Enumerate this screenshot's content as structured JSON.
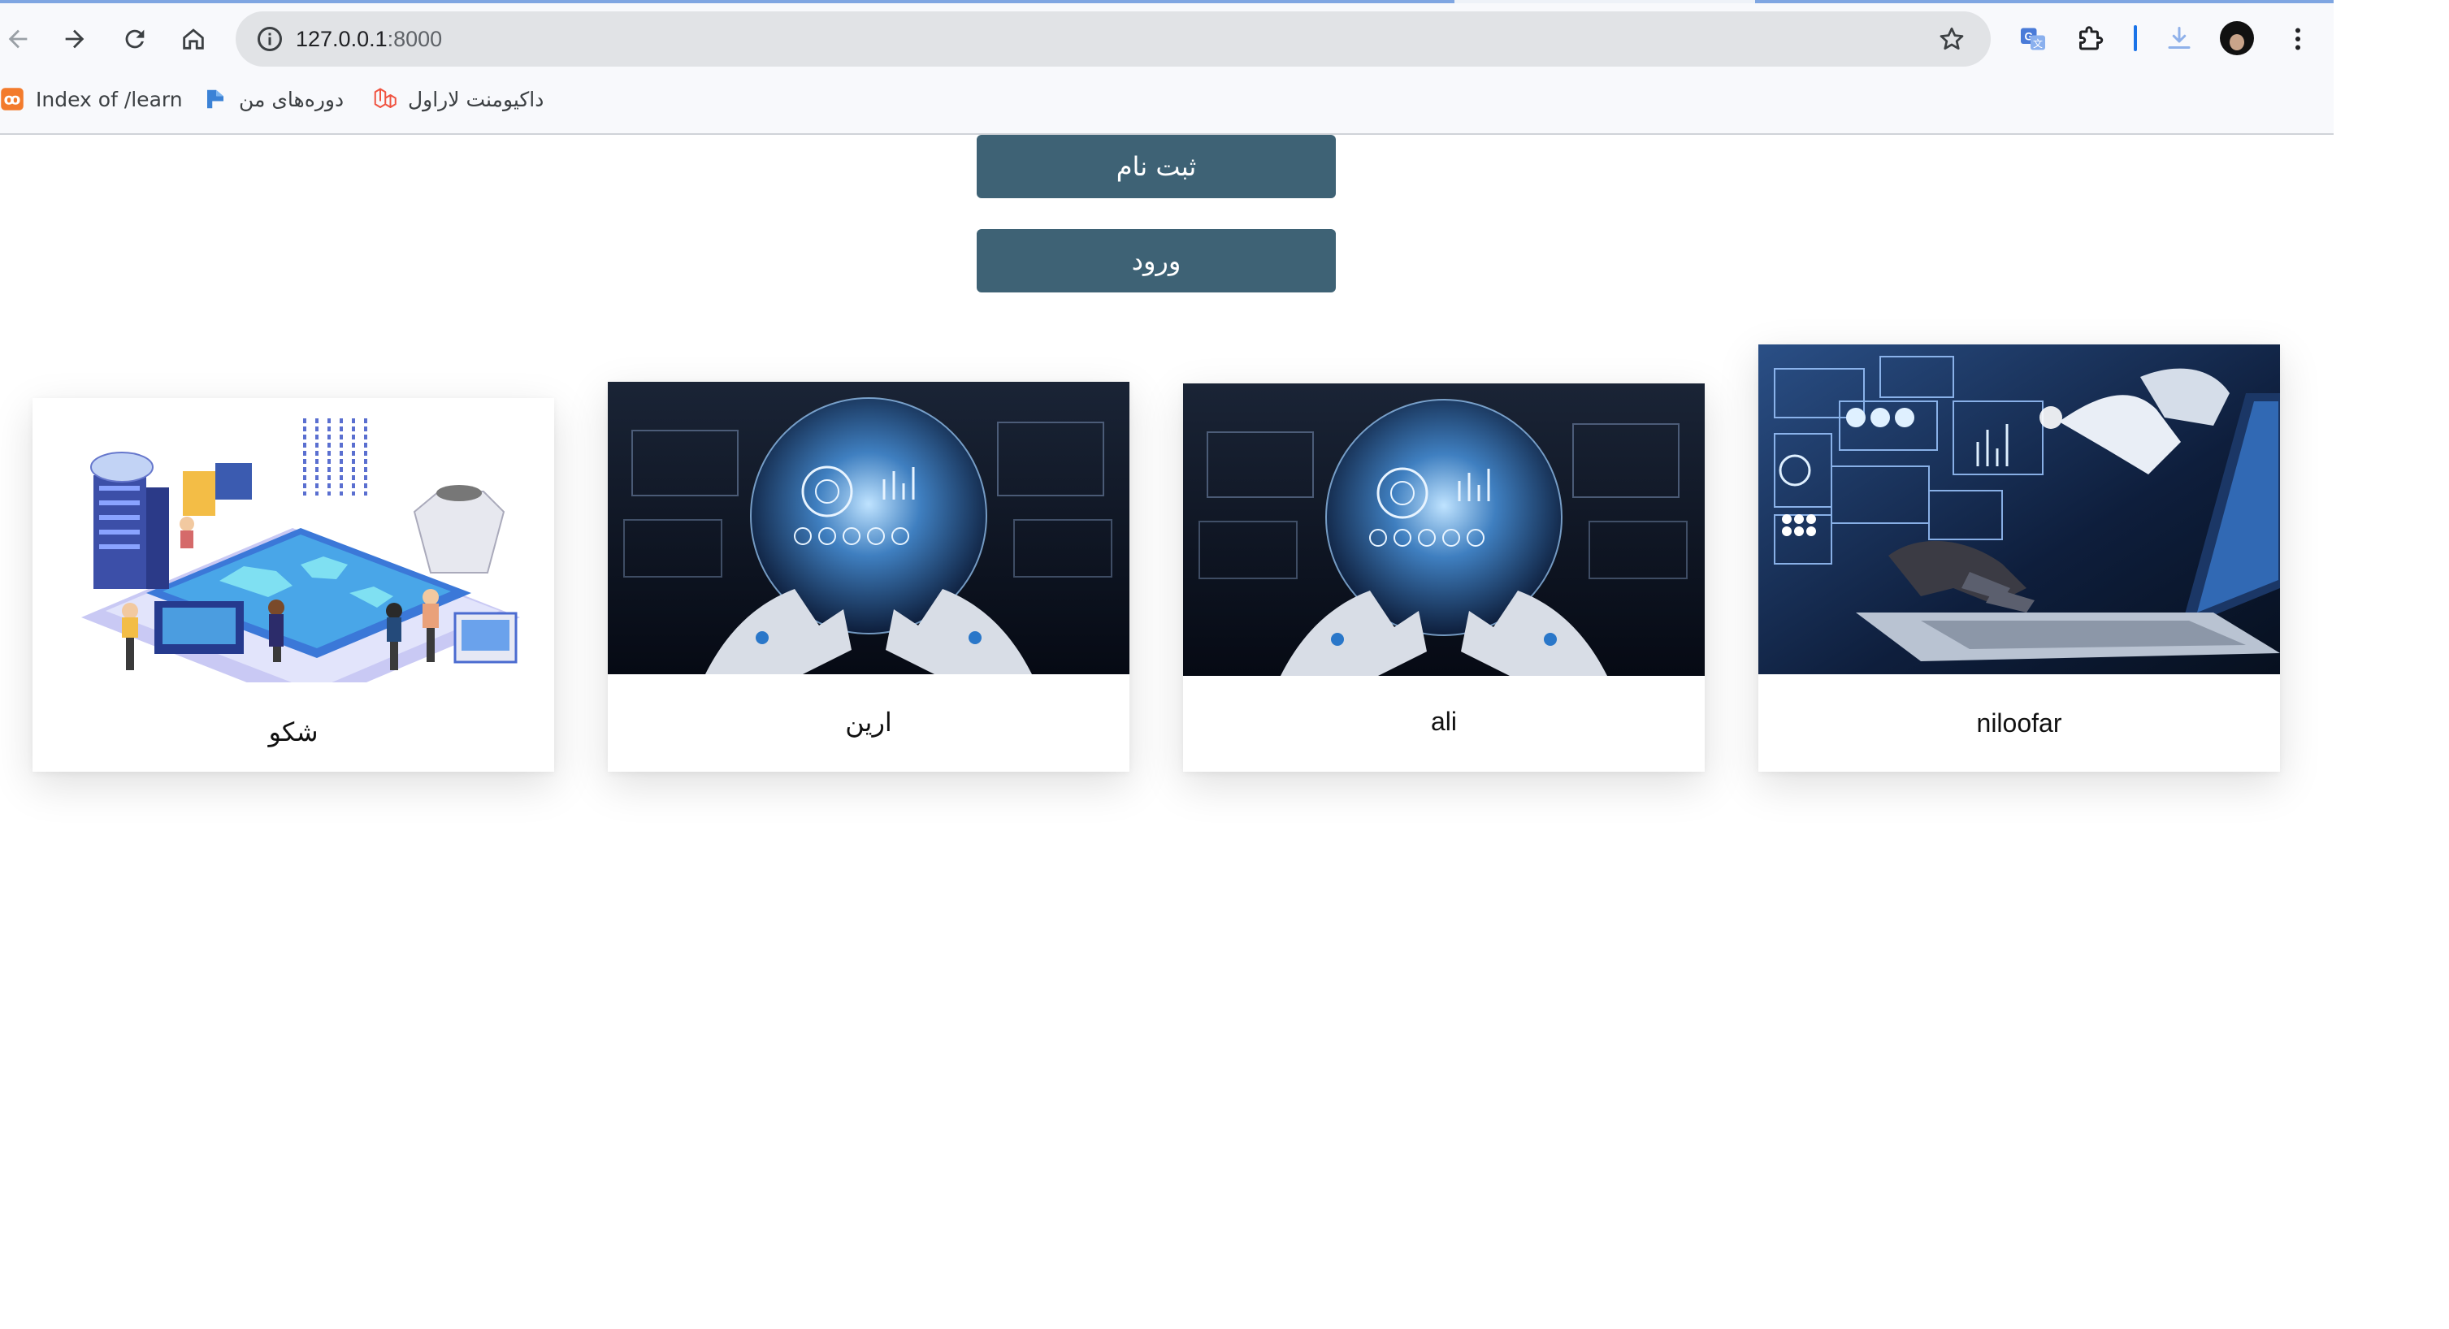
{
  "browser": {
    "url_host": "127.0.0.1",
    "url_port": ":8000",
    "bookmarks": [
      {
        "label": "Index of /learn",
        "icon": "xampp-icon"
      },
      {
        "label": "دوره‌های من",
        "icon": "course-icon"
      },
      {
        "label": "داکیومنت لاراول",
        "icon": "laravel-icon"
      }
    ],
    "icons": {
      "back": "arrow-left-icon",
      "forward": "arrow-right-icon",
      "reload": "reload-icon",
      "home": "home-icon",
      "site_info": "info-icon",
      "bookmark": "star-icon",
      "translate": "translate-icon",
      "extensions": "puzzle-icon",
      "downloads": "download-icon",
      "menu": "more-vert-icon"
    }
  },
  "page": {
    "register_label": "ثبت نام",
    "login_label": "ورود",
    "cards": [
      {
        "name": "شکو",
        "image": "isometric-data-center-illustration"
      },
      {
        "name": "ارین",
        "image": "robot-hands-holographic-globe"
      },
      {
        "name": "ali",
        "image": "robot-hands-holographic-globe"
      },
      {
        "name": "niloofar",
        "image": "robot-and-human-typing-on-laptop"
      }
    ]
  },
  "colors": {
    "button_bg": "#3e6275",
    "button_text": "#ffffff",
    "omnibox_bg": "#e1e3e6",
    "accent": "#1a73e8"
  }
}
